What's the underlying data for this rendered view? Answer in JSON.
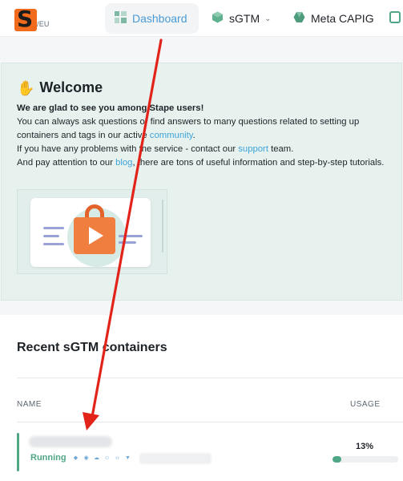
{
  "brand": {
    "logo_letter": "S",
    "region": "/EU",
    "brand_color": "#f26a1b"
  },
  "nav": {
    "items": [
      {
        "label": "Dashboard",
        "icon": "dashboard-grid-icon",
        "active": true
      },
      {
        "label": "sGTM",
        "icon": "cube-icon",
        "has_dropdown": true
      },
      {
        "label": "Meta CAPIG",
        "icon": "hexagon-icon"
      },
      {
        "label": "",
        "icon": "signal-hub-icon"
      }
    ],
    "active_color": "#4a9bd5"
  },
  "welcome": {
    "title": "Welcome",
    "icon": "waving-hand-icon",
    "lead": "We are glad to see you among Stape users!",
    "line1_pre": "You can always ask questions or find answers to many questions related to setting up containers and tags in our active ",
    "line1_link": "community",
    "line1_post": ".",
    "line2_pre": "If you have any problems with the service - contact our ",
    "line2_link": "support",
    "line2_post": " team.",
    "line3_pre": "And pay attention to our ",
    "line3_link": "blog",
    "line3_post": ", there are tons of useful information and step-by-step tutorials.",
    "illustration": "video-tutorial-icon",
    "background": "#e7f2ef",
    "link_color": "#3ea3d9"
  },
  "recent": {
    "title": "Recent sGTM containers",
    "columns": {
      "name": "NAME",
      "usage": "USAGE"
    },
    "rows": [
      {
        "status": "Running",
        "usage_label": "13%",
        "usage_fraction": 0.13,
        "status_color": "#4fa786"
      }
    ]
  },
  "annotation": {
    "type": "arrow",
    "color": "#e2231a"
  }
}
